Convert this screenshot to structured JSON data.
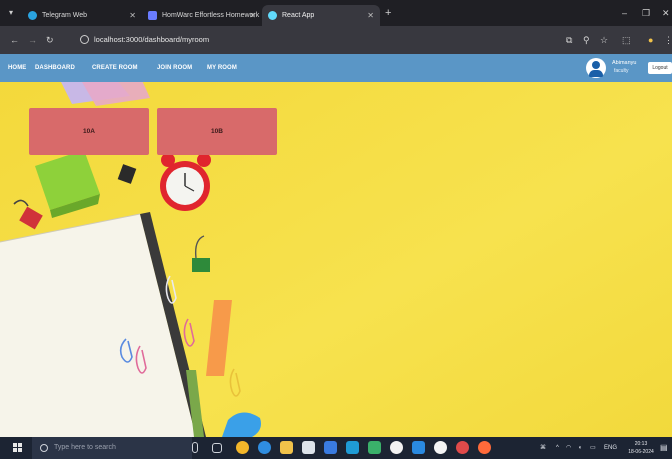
{
  "browser": {
    "tabs": [
      {
        "title": "Telegram Web",
        "active": false,
        "favicon_color": "#2aa3e0"
      },
      {
        "title": "HomWarc Effortless Homework",
        "active": false,
        "favicon_color": "#6a7cff"
      },
      {
        "title": "React App",
        "active": true,
        "favicon_color": "#61dafb"
      }
    ],
    "new_tab": "+",
    "url": "localhost:3000/dashboard/myroom"
  },
  "app": {
    "nav": {
      "home": "HOME",
      "dashboard": "DASHBOARD",
      "create_room": "CREATE ROOM",
      "join_room": "JOIN ROOM",
      "my_room": "MY ROOM"
    },
    "user": {
      "name": "Abimanyu",
      "role": "faculty",
      "logout": "Logout"
    },
    "rooms": [
      {
        "label": "10A"
      },
      {
        "label": "10B"
      }
    ],
    "colors": {
      "nav_bg": "#5a96c6",
      "card_bg": "#d86a6a",
      "page_bg": "#f6df4a"
    }
  },
  "taskbar": {
    "search_placeholder": "Type here to search",
    "tray_lang": "ENG",
    "time": "20:13",
    "date": "18-06-2024"
  }
}
